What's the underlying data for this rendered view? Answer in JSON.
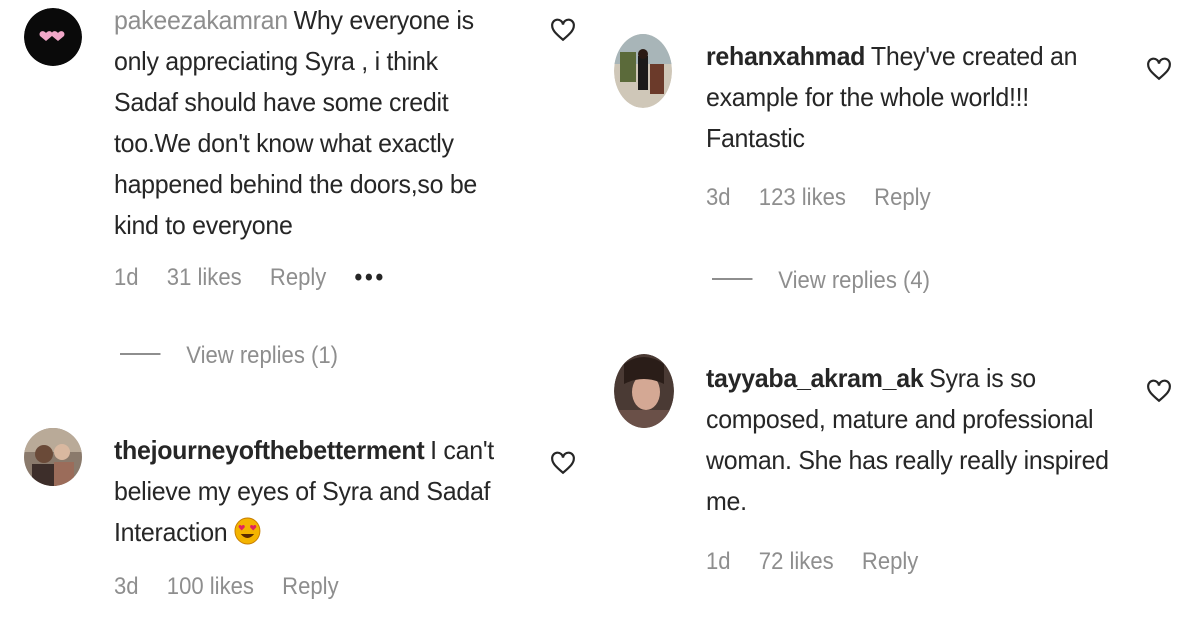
{
  "comments": [
    {
      "username": "pakeezakamran",
      "text": "Why everyone is only appreciating Syra , i think Sadaf should have some credit too.We don't know what exactly happened behind the doors,so be kind to everyone",
      "time": "1d",
      "likes": "31 likes",
      "reply": "Reply",
      "more": "•••",
      "view_replies": "View replies (1)"
    },
    {
      "username": "thejourneyofthebetterment",
      "text": "I can't believe my eyes of Syra and Sadaf Interaction",
      "emoji": "heart-eyes-emoji",
      "time": "3d",
      "likes": "100 likes",
      "reply": "Reply"
    },
    {
      "username": "rehanxahmad",
      "text": "They've created an example for the whole world!!! Fantastic",
      "time": "3d",
      "likes": "123 likes",
      "reply": "Reply",
      "view_replies": "View replies (4)"
    },
    {
      "username": "tayyaba_akram_ak",
      "text": "Syra is so composed, mature and professional woman. She has really really inspired me.",
      "time": "1d",
      "likes": "72 likes",
      "reply": "Reply"
    }
  ],
  "icons": {
    "like": "heart-outline-icon",
    "avatar_1": "pink-hearts-avatar"
  },
  "colors": {
    "text": "#262626",
    "muted": "#8e8e8e",
    "background": "#ffffff"
  }
}
